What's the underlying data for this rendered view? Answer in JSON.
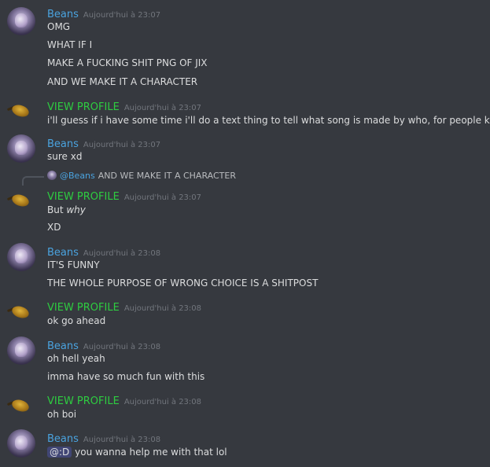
{
  "messages": [
    {
      "user": "Beans",
      "time": "Aujourd'hui à 23:07",
      "lines": [
        "OMG",
        "WHAT IF I",
        "MAKE A FUCKING SHIT PNG OF JIX",
        "AND WE MAKE IT A CHARACTER"
      ]
    },
    {
      "user": "VIEW PROFILE",
      "time": "Aujourd'hui à 23:07",
      "lines": [
        "i'll guess if i have some time i'll do a text thing to tell what song is made by who, for people knows"
      ]
    },
    {
      "user": "Beans",
      "time": "Aujourd'hui à 23:07",
      "lines": [
        "sure xd"
      ]
    },
    {
      "reply": {
        "user": "@Beans",
        "text": "AND WE MAKE IT A CHARACTER"
      },
      "user": "VIEW PROFILE",
      "time": "Aujourd'hui à 23:07",
      "lines_parts": [
        {
          "prefix": "But ",
          "italic": "why"
        },
        "XD"
      ]
    },
    {
      "user": "Beans",
      "time": "Aujourd'hui à 23:08",
      "lines": [
        "IT'S FUNNY",
        "THE WHOLE PURPOSE OF WRONG CHOICE IS A SHITPOST"
      ]
    },
    {
      "user": "VIEW PROFILE",
      "time": "Aujourd'hui à 23:08",
      "lines": [
        "ok go ahead"
      ]
    },
    {
      "user": "Beans",
      "time": "Aujourd'hui à 23:08",
      "lines": [
        "oh hell yeah",
        "imma have so much fun with this"
      ]
    },
    {
      "user": "VIEW PROFILE",
      "time": "Aujourd'hui à 23:08",
      "lines": [
        "oh boi"
      ]
    },
    {
      "user": "Beans",
      "time": "Aujourd'hui à 23:08",
      "mention": "@:D",
      "lines": [
        "you wanna help me with that lol"
      ]
    }
  ],
  "colors": {
    "background": "#36393f",
    "beans_username": "#4aa3df",
    "profile_username": "#2ecc40",
    "timestamp": "#72767d",
    "text": "#dcddde"
  },
  "icons": {
    "beans_avatar": "avatar-image",
    "profile_avatar": "frying-pan-icon"
  }
}
